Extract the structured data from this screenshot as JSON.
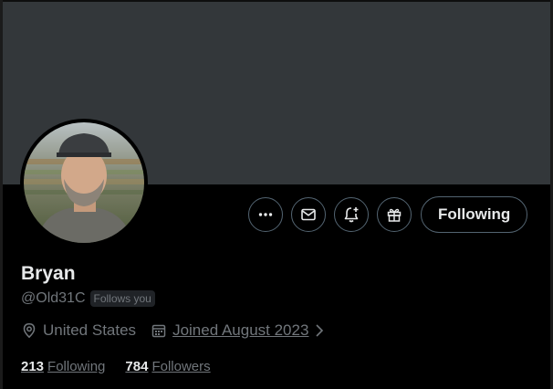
{
  "profile": {
    "display_name": "Bryan",
    "handle": "@Old31C",
    "follows_you_badge": "Follows you",
    "location": "United States",
    "joined": "Joined August 2023",
    "following_count": "213",
    "following_label": "Following",
    "followers_count": "784",
    "followers_label": "Followers"
  },
  "actions": {
    "more_icon": "more-horizontal-icon",
    "message_icon": "envelope-icon",
    "notify_icon": "bell-plus-icon",
    "subscribe_icon": "gift-icon",
    "following_button": "Following"
  },
  "colors": {
    "background": "#000000",
    "banner": "#33373a",
    "text_primary": "#e7e9ea",
    "text_secondary": "#71767b",
    "border": "#536471"
  }
}
